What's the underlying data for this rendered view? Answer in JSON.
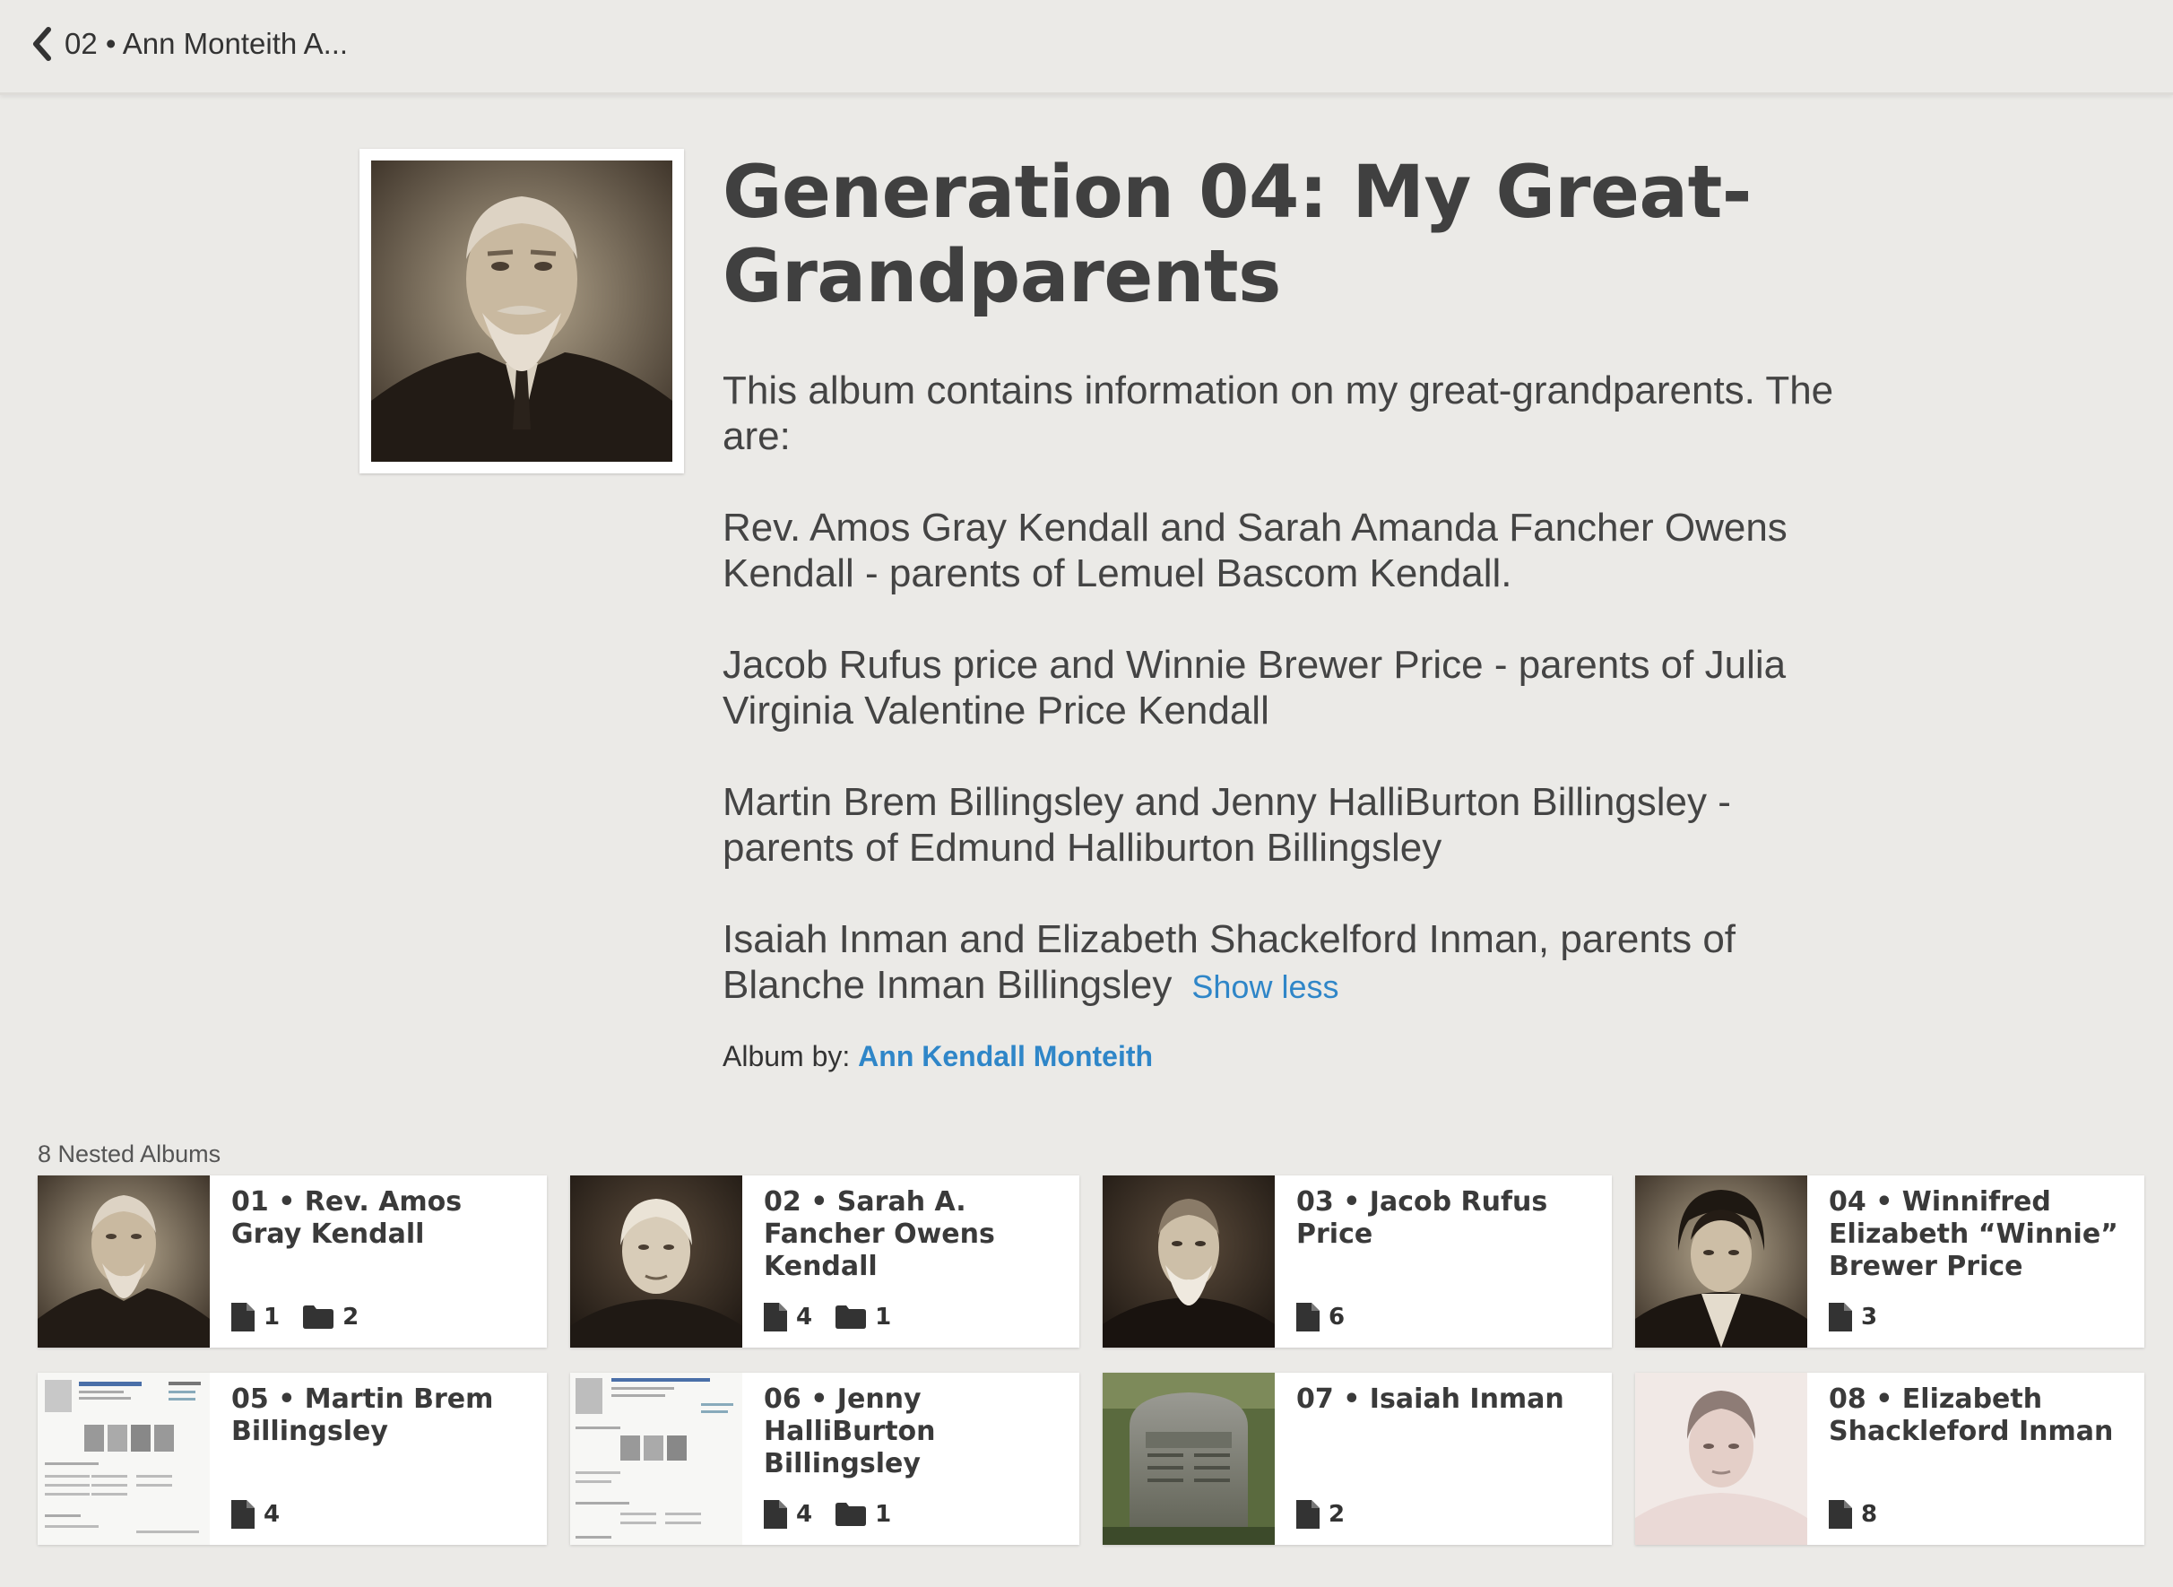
{
  "nav": {
    "back_label": "02 • Ann Monteith A..."
  },
  "album": {
    "title": "Generation 04: My Great-Grandparents",
    "description": [
      "This album contains information on my great-grandparents. The are:",
      "Rev. Amos Gray Kendall and Sarah Amanda Fancher Owens Kendall - parents of Lemuel Bascom Kendall.",
      "Jacob Rufus price and Winnie Brewer Price - parents of Julia Virginia Valentine Price Kendall",
      "Martin Brem Billingsley and Jenny HalliBurton Billingsley - parents of Edmund Halliburton Billingsley",
      "Isaiah Inman and Elizabeth Shackelford Inman, parents of Blanche Inman Billingsley"
    ],
    "show_less": "Show less",
    "by_label": "Album by:",
    "author": "Ann Kendall Monteith"
  },
  "nested": {
    "label": "8 Nested Albums",
    "cards": [
      {
        "title": "01 • Rev. Amos Gray Kendall",
        "thumb": "sepia portrait of bearded man",
        "files": "1",
        "folders": "2"
      },
      {
        "title": "02 • Sarah A. Fancher Owens Kendall",
        "thumb": "sepia portrait of elderly woman",
        "files": "4",
        "folders": "1"
      },
      {
        "title": "03 • Jacob Rufus Price",
        "thumb": "sepia portrait of bearded man",
        "files": "6",
        "folders": ""
      },
      {
        "title": "04 • Winnifred Elizabeth “Winnie” Brewer Price",
        "thumb": "sepia portrait of woman",
        "files": "3",
        "folders": ""
      },
      {
        "title": "05 • Martin Brem Billingsley",
        "thumb": "document screenshot",
        "files": "4",
        "folders": ""
      },
      {
        "title": "06 • Jenny HalliBurton Billingsley",
        "thumb": "document screenshot",
        "files": "4",
        "folders": "1"
      },
      {
        "title": "07 • Isaiah Inman",
        "thumb": "gravestone photo",
        "files": "2",
        "folders": ""
      },
      {
        "title": "08 • Elizabeth Shackleford Inman",
        "thumb": "faded portrait of woman",
        "files": "8",
        "folders": ""
      }
    ]
  },
  "icons": {
    "back": "chevron-left-icon",
    "file": "file-icon",
    "folder": "folder-icon"
  },
  "colors": {
    "link": "#2f86c8",
    "background": "#ebeae7",
    "card": "#ffffff"
  }
}
